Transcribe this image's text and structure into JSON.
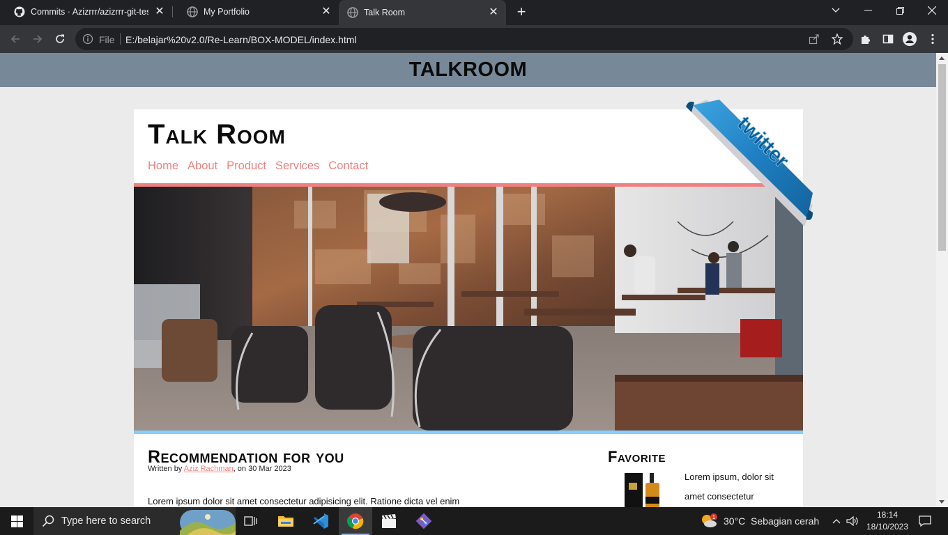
{
  "browser": {
    "tabs": [
      {
        "title": "Commits · Azizrrr/azizrrr-git-test",
        "icon": "github-icon"
      },
      {
        "title": "My Portfolio",
        "icon": "globe-icon"
      },
      {
        "title": "Talk Room",
        "icon": "globe-icon",
        "active": true
      }
    ],
    "address": {
      "scheme_label": "File",
      "url": "E:/belajar%20v2.0/Re-Learn/BOX-MODEL/index.html"
    }
  },
  "page": {
    "banner_title": "TALKROOM",
    "site_title": "Talk Room",
    "nav": [
      "Home",
      "About",
      "Product",
      "Services",
      "Contact"
    ],
    "ribbon_text": "twitter",
    "hero_alt": "cafe interior photo",
    "article": {
      "title": "Recommendation for you",
      "byline_prefix": "Written by",
      "author": "Aziz Rachman",
      "byline_suffix": ", on 30 Mar 2023",
      "body": "Lorem ipsum dolor sit amet consectetur adipisicing elit. Ratione dicta vel enim"
    },
    "aside": {
      "title": "Favorite",
      "items": [
        {
          "text": "Lorem ipsum, dolor sit amet consectetur"
        }
      ]
    },
    "colors": {
      "banner": "#778899",
      "accent": "#f08080",
      "hero_line": "#87cefa"
    }
  },
  "taskbar": {
    "search_placeholder": "Type here to search",
    "weather": "30°C  Sebagian cerah",
    "weather_badge": "1",
    "time": "18:14",
    "date": "18/10/2023",
    "apps": [
      "task-view-icon",
      "file-explorer-icon",
      "vscode-icon",
      "chrome-icon",
      "clapper-icon",
      "git-icon"
    ]
  }
}
